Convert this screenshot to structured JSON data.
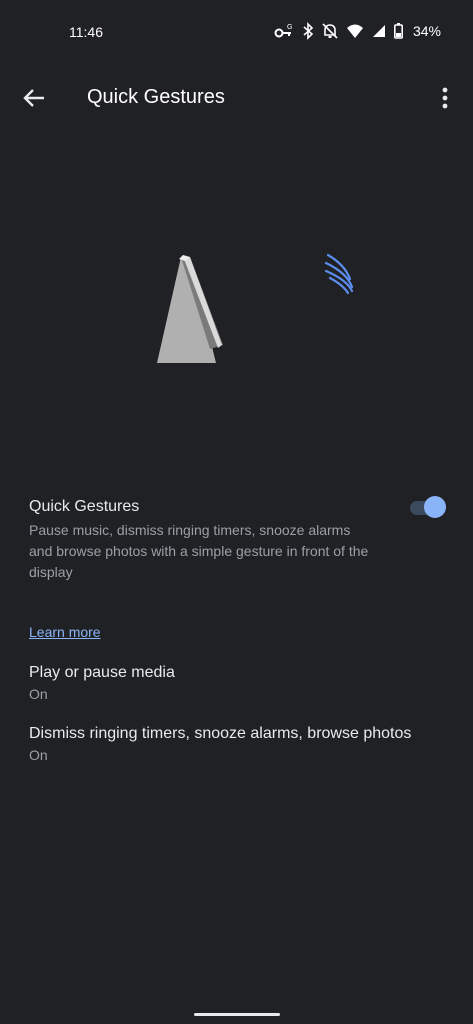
{
  "status_bar": {
    "time": "11:46",
    "battery": "34%",
    "icons": [
      "vpn-key-icon",
      "bluetooth-icon",
      "notifications-off-icon",
      "wifi-icon",
      "cellular-icon",
      "battery-icon"
    ]
  },
  "app_bar": {
    "title": "Quick Gestures",
    "back_icon": "back-arrow-icon",
    "menu_icon": "more-vert-icon"
  },
  "main_setting": {
    "label": "Quick Gestures",
    "description": "Pause music, dismiss ringing timers, snooze alarms and browse photos with a simple gesture in front of the display",
    "enabled": true
  },
  "learn_more": "Learn more",
  "options": [
    {
      "label": "Play or pause media",
      "value": "On"
    },
    {
      "label": "Dismiss ringing timers, snooze alarms, browse photos",
      "value": "On"
    }
  ],
  "colors": {
    "background": "#202124",
    "accent": "#8ab4f8",
    "secondary_text": "#9aa0a6"
  }
}
